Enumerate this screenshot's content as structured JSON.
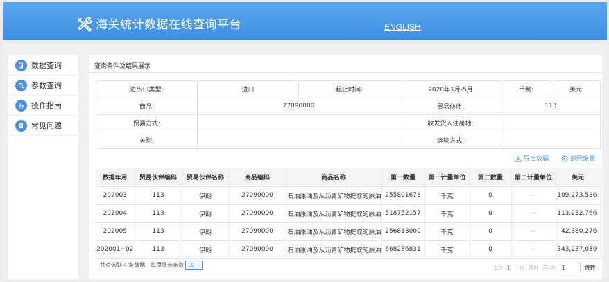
{
  "header": {
    "title": "海关统计数据在线查询平台",
    "english_link": "ENGLISH"
  },
  "sidebar": {
    "items": [
      {
        "label": "数据查询",
        "icon": "search-doc-icon"
      },
      {
        "label": "参数查询",
        "icon": "magnifier-icon"
      },
      {
        "label": "操作指南",
        "icon": "hand-icon"
      },
      {
        "label": "常见问题",
        "icon": "document-icon"
      }
    ]
  },
  "main": {
    "section_title": "查询条件及结果展示",
    "conditions": {
      "trade_type_label": "进出口类型:",
      "trade_type_value": "进口",
      "period_label": "起止时间:",
      "period_value": "2020年1月-5月",
      "currency_label": "币制:",
      "currency_value": "美元",
      "goods_label": "商品:",
      "goods_value": "27090000",
      "partner_label": "贸易伙伴:",
      "partner_value": "113",
      "trade_mode_label": "贸易方式:",
      "trade_mode_value": "",
      "consignee_label": "收发货人注册地:",
      "consignee_value": "",
      "customs_label": "关别:",
      "customs_value": "",
      "transport_label": "运输方式:",
      "transport_value": ""
    },
    "actions": {
      "export": "导出数据",
      "reset": "返回设置"
    },
    "table": {
      "headers": [
        "数据年月",
        "贸易伙伴编码",
        "贸易伙伴名称",
        "商品编码",
        "商品名称",
        "第一数量",
        "第一计量单位",
        "第二数量",
        "第二计量单位",
        "美元"
      ],
      "rows": [
        [
          "202003",
          "113",
          "伊朗",
          "27090000",
          "石油原油及从沥青矿物提取的原油",
          "255801678",
          "千克",
          "0",
          "—",
          "109,273,586"
        ],
        [
          "202004",
          "113",
          "伊朗",
          "27090000",
          "石油原油及从沥青矿物提取的原油",
          "518752157",
          "千克",
          "0",
          "—",
          "113,232,766"
        ],
        [
          "202005",
          "113",
          "伊朗",
          "27090000",
          "石油原油及从沥青矿物提取的原油",
          "256813000",
          "千克",
          "0",
          "—",
          "42,380,276"
        ],
        [
          "202001~02",
          "113",
          "伊朗",
          "27090000",
          "石油原油及从沥青矿物提取的原油",
          "668286831",
          "千克",
          "0",
          "—",
          "343,237,039"
        ]
      ]
    },
    "footer": {
      "total_prefix": "共查询到",
      "total_count": "4",
      "total_suffix": "条数据",
      "page_size_label": "每页显示条数",
      "page_size_value": "10",
      "prev": "上页",
      "current_page": "1",
      "next": "下页",
      "last": "尾页",
      "total_pages": "共1页",
      "page_input": "1",
      "jump": "跳转"
    }
  },
  "colors": {
    "header": "#4a99e8",
    "accent": "#4a8fe0"
  }
}
